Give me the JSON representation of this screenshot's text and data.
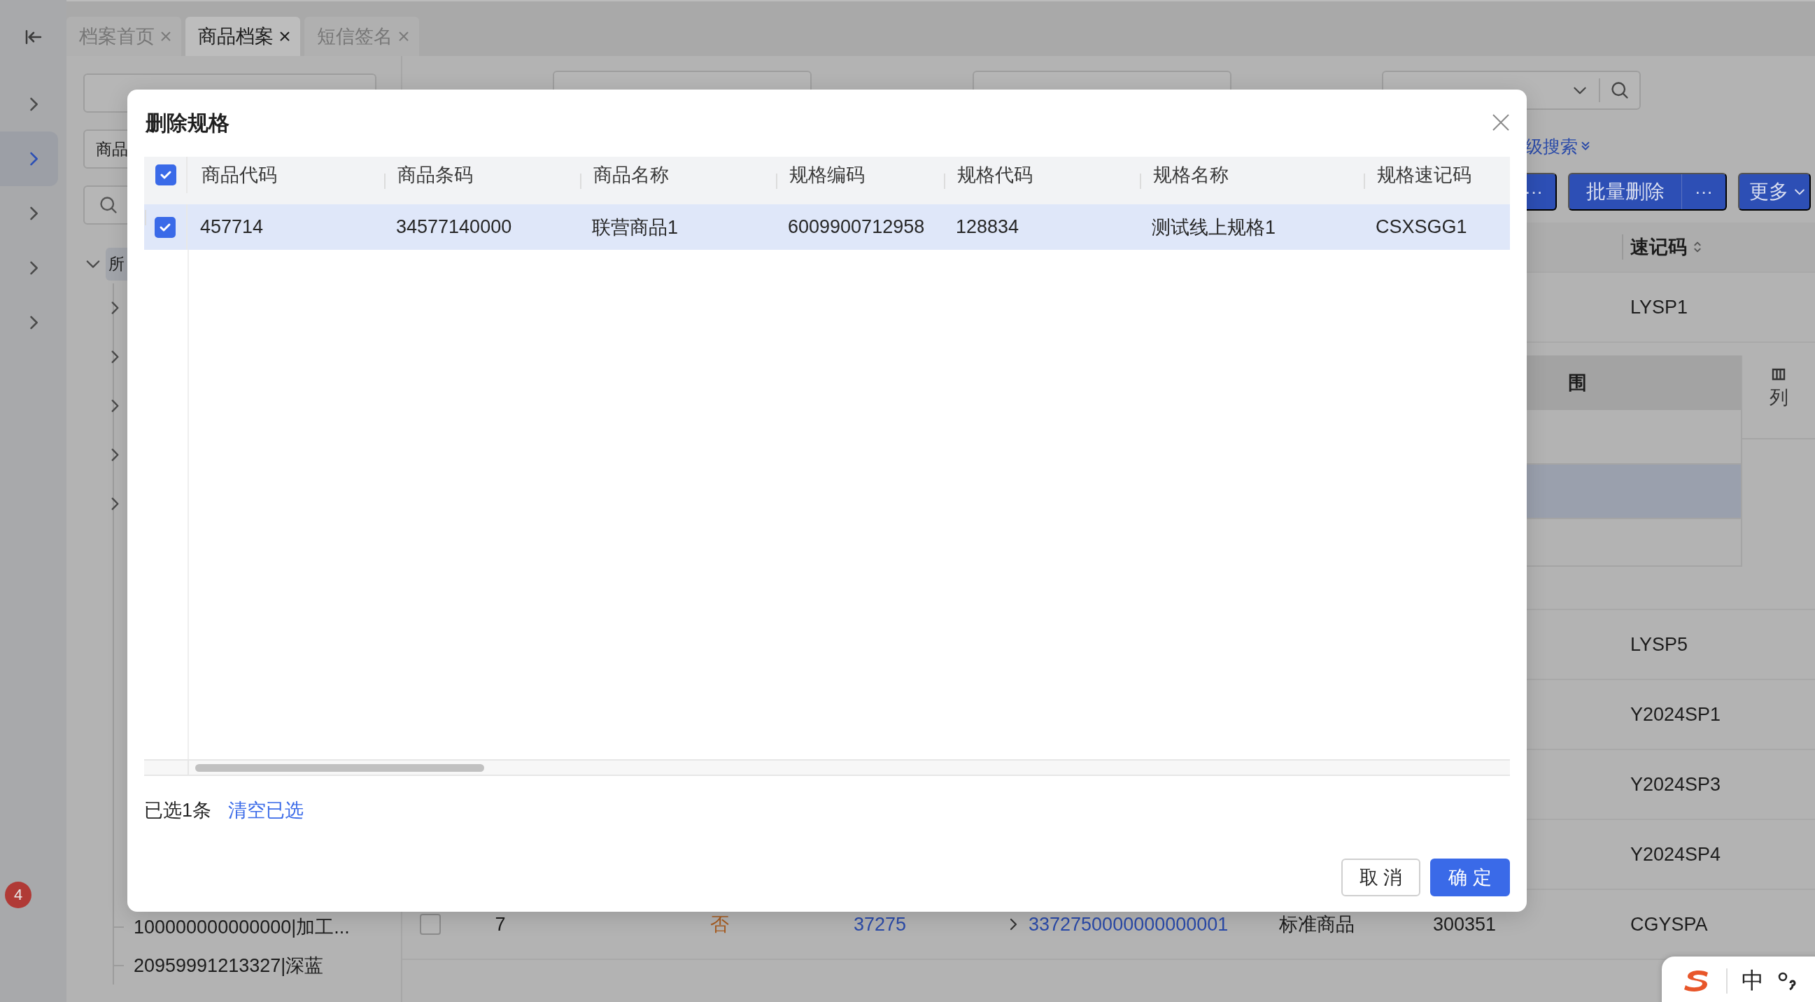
{
  "rail": {
    "items": [
      {
        "selected": false
      },
      {
        "selected": true
      },
      {
        "selected": false
      },
      {
        "selected": false
      },
      {
        "selected": false
      }
    ],
    "badge": "4"
  },
  "tabs": [
    {
      "label": "档案首页",
      "selected": false
    },
    {
      "label": "商品档案",
      "selected": true
    },
    {
      "label": "短信签名",
      "selected": false
    }
  ],
  "left_panel": {
    "select_2": "商品",
    "tree": {
      "label": "所",
      "expanded": true,
      "children": [
        {
          "expanded": false
        },
        {
          "expanded": false
        },
        {
          "expanded": false
        },
        {
          "expanded": false
        },
        {
          "expanded": false
        },
        {
          "label": "100000000000000|加工..."
        },
        {
          "label": "20959991213327|深蓝"
        }
      ]
    }
  },
  "advanced_search": "级搜索",
  "toolbar": [
    {
      "kind": "split",
      "more": "···"
    },
    {
      "kind": "split",
      "label": "批量删除",
      "more": "···"
    },
    {
      "kind": "dropdown",
      "label": "更多"
    }
  ],
  "table": {
    "columns": [
      "速记码"
    ],
    "rows": [
      {
        "kind": "row",
        "quick_code": "LYSP1"
      },
      {
        "kind": "detail",
        "detail_header": "围",
        "column_settings": "列"
      },
      {
        "kind": "row",
        "quick_code": "LYSP5"
      },
      {
        "kind": "row",
        "quick_code": "Y2024SP1"
      },
      {
        "kind": "row",
        "quick_code": "Y2024SP3"
      },
      {
        "kind": "row",
        "quick_code": "Y2024SP4"
      },
      {
        "kind": "row",
        "checked": false,
        "index": "7",
        "flag": "否",
        "code": "37275",
        "expanded": false,
        "barcode": "3372750000000000001",
        "type": "标准商品",
        "dept": "300351",
        "quick_code": "CGYSPA"
      }
    ]
  },
  "dialog": {
    "title": "删除规格",
    "header_checked": true,
    "columns": [
      "商品代码",
      "商品条码",
      "商品名称",
      "规格编码",
      "规格代码",
      "规格名称",
      "规格速记码"
    ],
    "rows": [
      {
        "selected": true,
        "cells": [
          "457714",
          "34577140000",
          "联营商品1",
          "6009900712958",
          "128834",
          "测试线上规格1",
          "CSXSGG1"
        ]
      }
    ],
    "selected_count": "已选1条",
    "clear_link": "清空已选",
    "cancel": "取 消",
    "ok": "确 定"
  },
  "ime": {
    "mode": "中"
  }
}
